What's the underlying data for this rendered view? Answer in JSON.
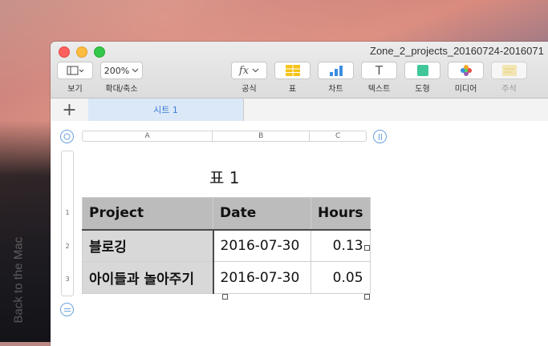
{
  "window": {
    "title": "Zone_2_projects_20160724-2016071"
  },
  "toolbar": {
    "buttons": [
      {
        "label": "보기",
        "icon": "view-icon"
      },
      {
        "label": "확대/축소",
        "value": "200%"
      },
      {
        "label": "공식",
        "glyph": "fx"
      },
      {
        "label": "표",
        "icon": "table-icon"
      },
      {
        "label": "차트",
        "icon": "chart-icon"
      },
      {
        "label": "텍스트",
        "glyph": "T"
      },
      {
        "label": "도형",
        "icon": "shape-icon"
      },
      {
        "label": "미디어",
        "icon": "media-icon"
      },
      {
        "label": "주석",
        "icon": "comment-icon"
      }
    ]
  },
  "tabs": {
    "add_glyph": "+",
    "sheets": [
      {
        "label": "시트 1",
        "active": true
      }
    ]
  },
  "spreadsheet": {
    "column_headers": [
      "A",
      "B",
      "C"
    ],
    "row_headers": [
      "1",
      "2",
      "3"
    ],
    "table_title": "표 1",
    "header_row": [
      "Project",
      "Date",
      "Hours"
    ],
    "rows": [
      [
        "블로깅",
        "2016-07-30",
        "0.13"
      ],
      [
        "아이들과 놀아주기",
        "2016-07-30",
        "0.05"
      ]
    ]
  },
  "desktop": {
    "watermark": "Back to the Mac"
  },
  "colors": {
    "accent": "#3a7bd5",
    "table_header_bg": "#bcbcbc",
    "row_header_bg": "#d8d8d8",
    "sheet_tab_bg": "#dbe8f7"
  }
}
